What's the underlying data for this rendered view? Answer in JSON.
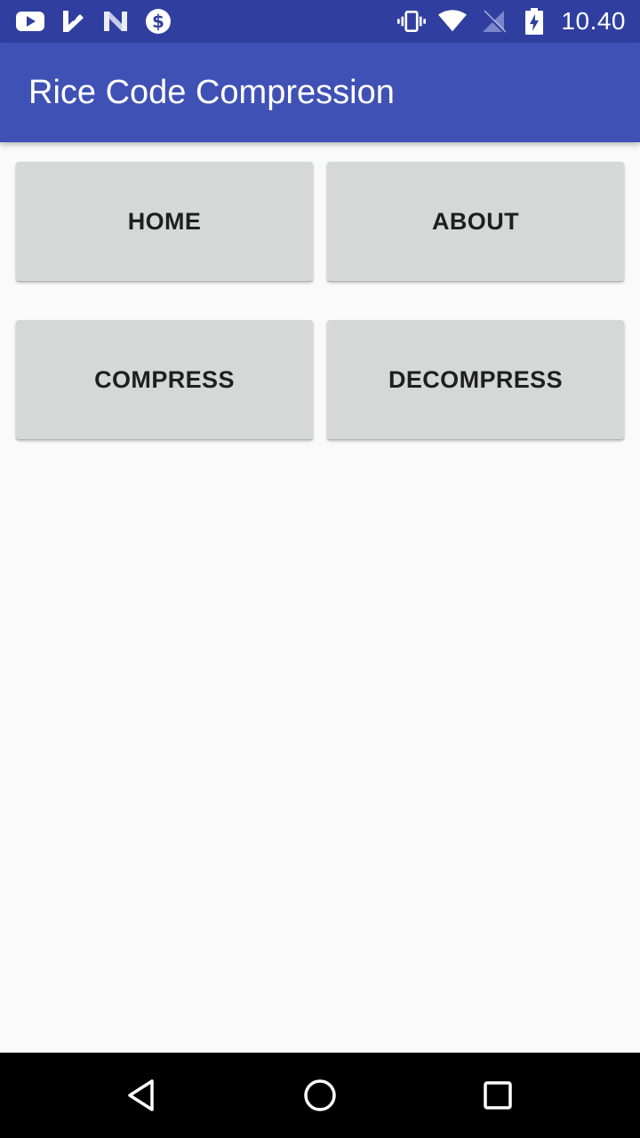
{
  "status_bar": {
    "notification_icons": [
      "youtube-icon",
      "checkmark-app-icon",
      "n-app-icon",
      "dollar-icon"
    ],
    "system_icons": [
      "vibrate-icon",
      "wifi-icon",
      "no-signal-icon",
      "battery-charging-icon"
    ],
    "time": "10.40"
  },
  "app_bar": {
    "title": "Rice Code Compression",
    "color": "#3f51b5"
  },
  "buttons": {
    "home": "HOME",
    "about": "ABOUT",
    "compress": "COMPRESS",
    "decompress": "DECOMPRESS"
  },
  "nav_bar": {
    "icons": [
      "back-icon",
      "home-circle-icon",
      "recents-icon"
    ]
  },
  "colors": {
    "status_bar": "#303f9f",
    "app_bar": "#3f51b5",
    "button_bg": "#d6d7d7",
    "background": "#fafafa"
  }
}
